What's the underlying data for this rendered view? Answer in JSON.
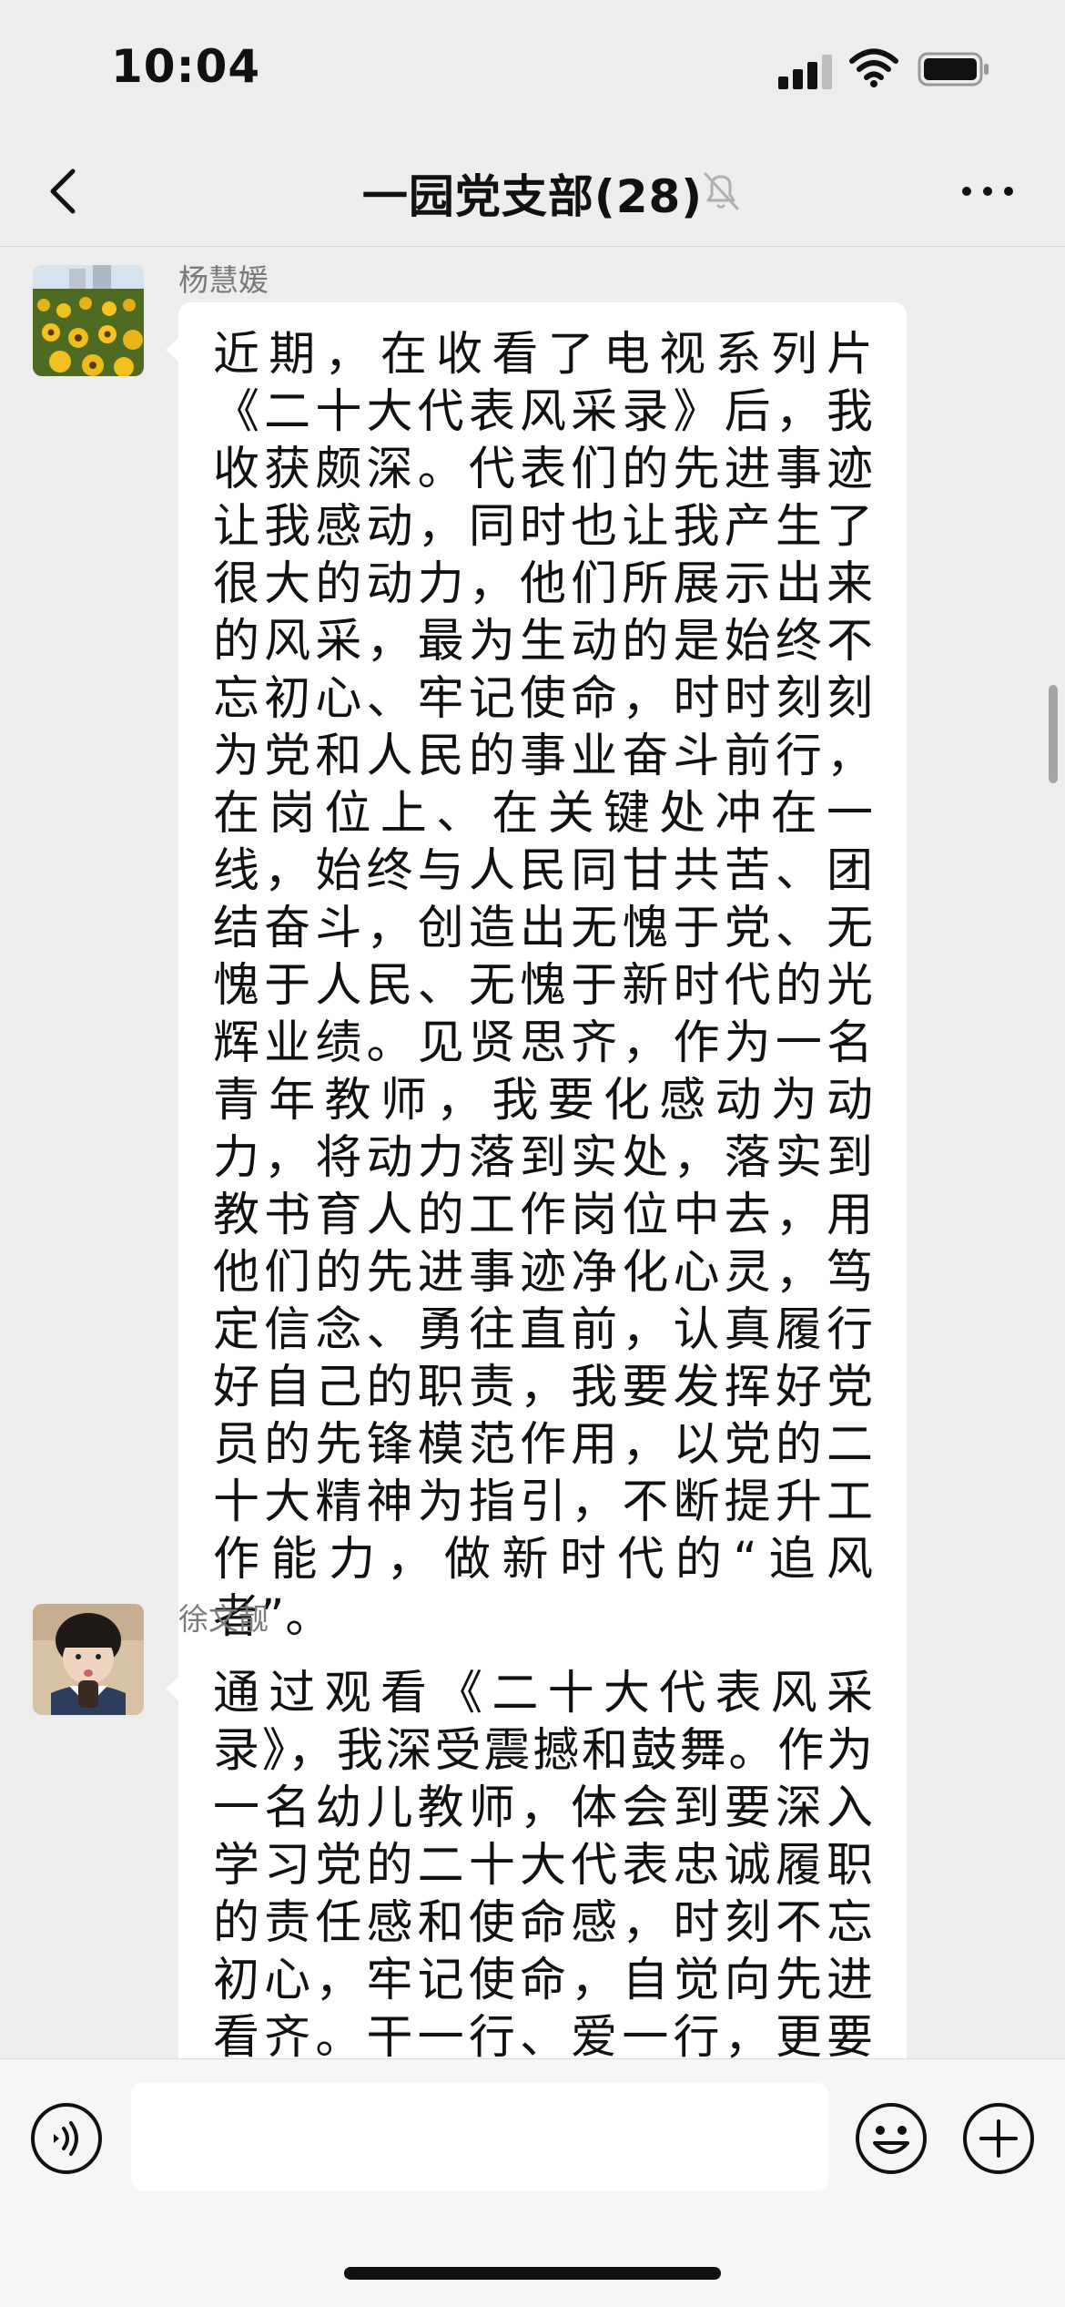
{
  "status_bar": {
    "time": "10:04"
  },
  "nav": {
    "title": "一园党支部(28)",
    "muted": true
  },
  "messages": [
    {
      "sender": "杨慧媛",
      "avatar": "sunflower-field-photo",
      "text": "近期，在收看了电视系列片《二十大代表风采录》后，我收获颇深。代表们的先进事迹让我感动，同时也让我产生了很大的动力，他们所展示出来的风采，最为生动的是始终不忘初心、牢记使命，时时刻刻为党和人民的事业奋斗前行，在岗位上、在关键处冲在一线，始终与人民同甘共苦、团结奋斗，创造出无愧于党、无愧于人民、无愧于新时代的光辉业绩。见贤思齐，作为一名青年教师，我要化感动为动力，将动力落到实处，落实到教书育人的工作岗位中去，用他们的先进事迹净化心灵，笃定信念、勇往直前，认真履行好自己的职责，我要发挥好党员的先锋模范作用，以党的二十大精神为指引，不断提升工作能力，做新时代的“追风者”。"
    },
    {
      "sender": "徐文靓",
      "avatar": "child-portrait-photo",
      "text": "通过观看《二十大代表风采录》，我深受震撼和鼓舞。作为一名幼儿教师，体会到要深入学习党的二十大代表忠诚履职的责任感和使命感，时刻不忘初心，牢记使命，自觉向先进看齐。干一行、爱一行，更要专一行、精一"
    }
  ],
  "input": {
    "placeholder": ""
  },
  "icons": {
    "back": "chevron-left-icon",
    "mute": "bell-muted-icon",
    "more": "more-dots-icon",
    "voice": "voice-input-icon",
    "emoji": "emoji-icon",
    "plus": "plus-icon"
  }
}
